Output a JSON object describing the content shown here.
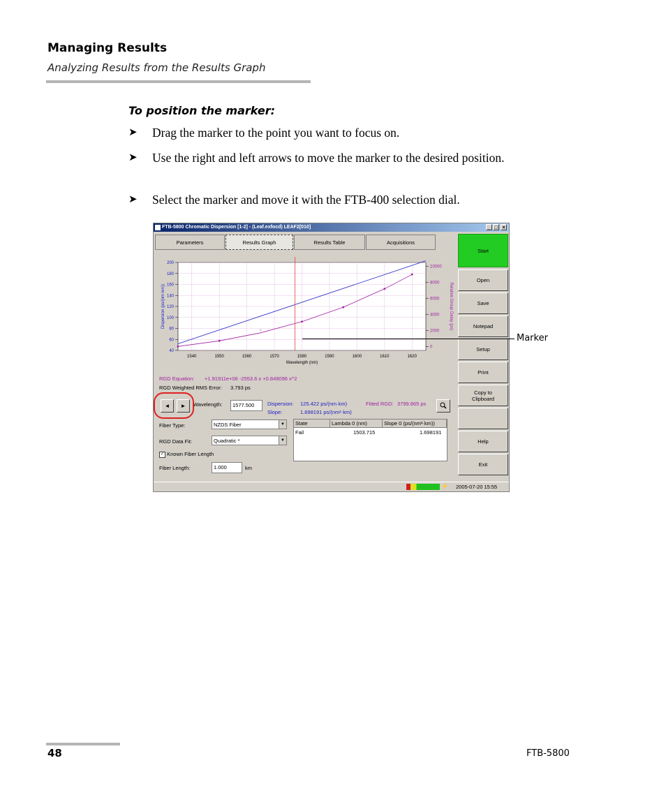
{
  "header": {
    "section_title": "Managing Results",
    "subtitle": "Analyzing Results from the Results Graph"
  },
  "procedure": {
    "title": "To position the marker:",
    "steps": [
      "Drag the marker to the point you want to focus on.",
      "Use the right and left arrows to move the marker to the desired position.",
      "Select the marker and move it with the FTB-400 selection dial."
    ],
    "bullet": "➤"
  },
  "screenshot": {
    "window_title": "FTB-5800 Chromatic Dispersion  [1-2] - (Leaf.exfocd) LEAF2[010]",
    "window_buttons": [
      "_",
      "□",
      "×"
    ],
    "tabs": [
      "Parameters",
      "Results Graph",
      "Results Table",
      "Acquisitions"
    ],
    "side_buttons": [
      "Start",
      "Open",
      "Save",
      "Notepad",
      "Setup",
      "Print",
      "Copy to\nClipboard",
      "",
      "Help",
      "Exit"
    ],
    "rgd_equation_label": "RGD Equation:",
    "rgd_equation_value": "+1.91911e+06 -2553.6 x +0.849096 x^2",
    "rms_label": "RGD Weighted RMS Error:",
    "rms_value": "3.793 ps",
    "wavelength_label": "Wavelength:",
    "wavelength_value": "1577.500",
    "dispersion_label": "Dispersion:",
    "dispersion_value": "125.422 ps/(nm·km)",
    "slope_label": "Slope:",
    "slope_value": "1.698191 ps/(nm²·km)",
    "fitted_rgd_label": "Fitted RGD:",
    "fitted_rgd_value": "3799.865 ps",
    "fiber_type_label": "Fiber Type:",
    "fiber_type_value": "NZDS Fiber",
    "rgd_fit_label": "RGD Data Fit:",
    "rgd_fit_value": "Quadratic *",
    "known_length_label": "Known Fiber Length",
    "known_length_checked": true,
    "fiber_length_label": "Fiber Length:",
    "fiber_length_value": "1.000",
    "fiber_length_unit": "km",
    "table_headers": [
      "State",
      "Lambda  0 (nm)",
      "Slope 0 (ps/(nm²·km))"
    ],
    "table_rows": [
      [
        "Fail",
        "1503.715",
        "1.698191"
      ]
    ],
    "status_datetime": "2005-07-20 15:55",
    "left_arrow": "◄",
    "right_arrow": "►",
    "zoom_icon": "magnifier-icon"
  },
  "chart_data": {
    "type": "line",
    "title": "",
    "xlabel": "Wavelength (nm)",
    "ylabel": "Dispersion (ps/(nm·km))",
    "y2label": "Relative Group Delay (ps)",
    "xlim": [
      1535,
      1625
    ],
    "ylim": [
      40,
      200
    ],
    "y2lim": [
      -500,
      10500
    ],
    "x_ticks": [
      1540,
      1550,
      1560,
      1570,
      1580,
      1590,
      1600,
      1610,
      1620
    ],
    "y_ticks": [
      40,
      60,
      80,
      100,
      120,
      140,
      160,
      180,
      200
    ],
    "y2_ticks": [
      0,
      2000,
      4000,
      6000,
      8000,
      10000
    ],
    "grid": true,
    "marker_x": 1577.5,
    "series": [
      {
        "color": "#2020c0",
        "axis": "left",
        "x": [
          1535,
          1625
        ],
        "y": [
          52,
          203
        ]
      },
      {
        "color": "#a020a0",
        "axis": "right",
        "x": [
          1535,
          1550,
          1565,
          1580,
          1595,
          1610,
          1620
        ],
        "y": [
          0,
          700,
          1700,
          3100,
          4900,
          7200,
          9000
        ]
      }
    ],
    "purple_points_x": [
      1535,
      1550,
      1580,
      1595,
      1610,
      1620
    ],
    "outlier": {
      "x": 1565,
      "y": 2050
    },
    "colors": {
      "grid": "#e0b0e0",
      "marker": "#e04040"
    }
  },
  "callout": {
    "label": "Marker"
  },
  "footer": {
    "page_number": "48",
    "product": "FTB-5800"
  }
}
